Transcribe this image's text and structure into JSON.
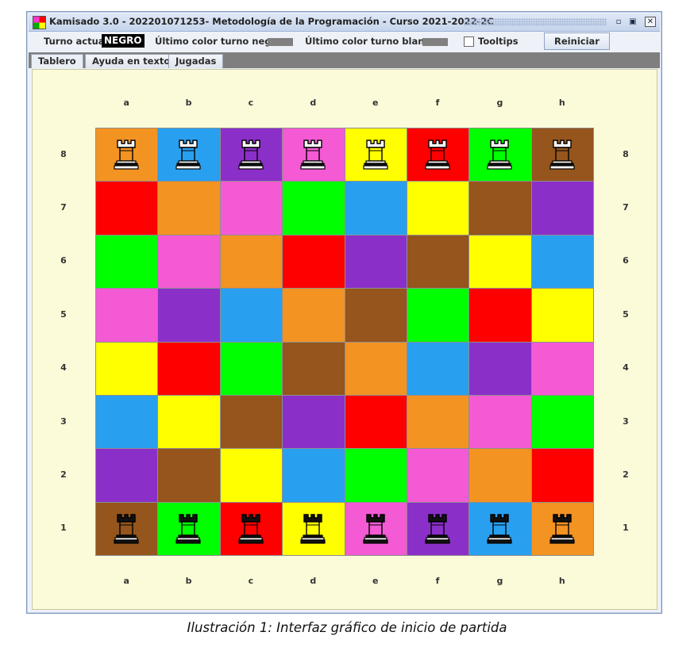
{
  "window": {
    "title": "Kamisado 3.0 - 202201071253- Metodología de la Programación - Curso 2021-2022-2C",
    "controls": [
      "minimize",
      "maximize",
      "close"
    ]
  },
  "toolbar": {
    "turn_label": "Turno actual:",
    "turn_value": "NEGRO",
    "last_black_label": "Último color turno negro:",
    "last_white_label": "Último color turno blanco:",
    "last_color_swatch": "#808080",
    "tooltips_label": "Tooltips",
    "tooltips_checked": false,
    "reset_label": "Reiniciar"
  },
  "tabs": [
    {
      "label": "Tablero",
      "active": true
    },
    {
      "label": "Ayuda en texto",
      "active": false
    },
    {
      "label": "Jugadas",
      "active": false
    }
  ],
  "board": {
    "files": [
      "a",
      "b",
      "c",
      "d",
      "e",
      "f",
      "g",
      "h"
    ],
    "ranks": [
      "8",
      "7",
      "6",
      "5",
      "4",
      "3",
      "2",
      "1"
    ],
    "palette": {
      "orange": "#f39322",
      "blue": "#29a0ef",
      "purple": "#8b2fc9",
      "pink": "#f45ad4",
      "yellow": "#ffff00",
      "red": "#ff0000",
      "green": "#00ff00",
      "brown": "#95551c"
    },
    "rows": [
      [
        "orange",
        "blue",
        "purple",
        "pink",
        "yellow",
        "red",
        "green",
        "brown"
      ],
      [
        "red",
        "orange",
        "pink",
        "green",
        "blue",
        "yellow",
        "brown",
        "purple"
      ],
      [
        "green",
        "pink",
        "orange",
        "red",
        "purple",
        "brown",
        "yellow",
        "blue"
      ],
      [
        "pink",
        "purple",
        "blue",
        "orange",
        "brown",
        "green",
        "red",
        "yellow"
      ],
      [
        "yellow",
        "red",
        "green",
        "brown",
        "orange",
        "blue",
        "purple",
        "pink"
      ],
      [
        "blue",
        "yellow",
        "brown",
        "purple",
        "red",
        "orange",
        "pink",
        "green"
      ],
      [
        "purple",
        "brown",
        "yellow",
        "blue",
        "green",
        "pink",
        "orange",
        "red"
      ],
      [
        "brown",
        "green",
        "red",
        "yellow",
        "pink",
        "purple",
        "blue",
        "orange"
      ]
    ],
    "pieces": {
      "white_rank": "8",
      "white_colors": [
        "orange",
        "blue",
        "purple",
        "pink",
        "yellow",
        "red",
        "green",
        "brown"
      ],
      "black_rank": "1",
      "black_colors": [
        "brown",
        "green",
        "red",
        "yellow",
        "pink",
        "purple",
        "blue",
        "orange"
      ]
    }
  },
  "caption": "Ilustración 1: Interfaz gráfico de inicio de partida"
}
